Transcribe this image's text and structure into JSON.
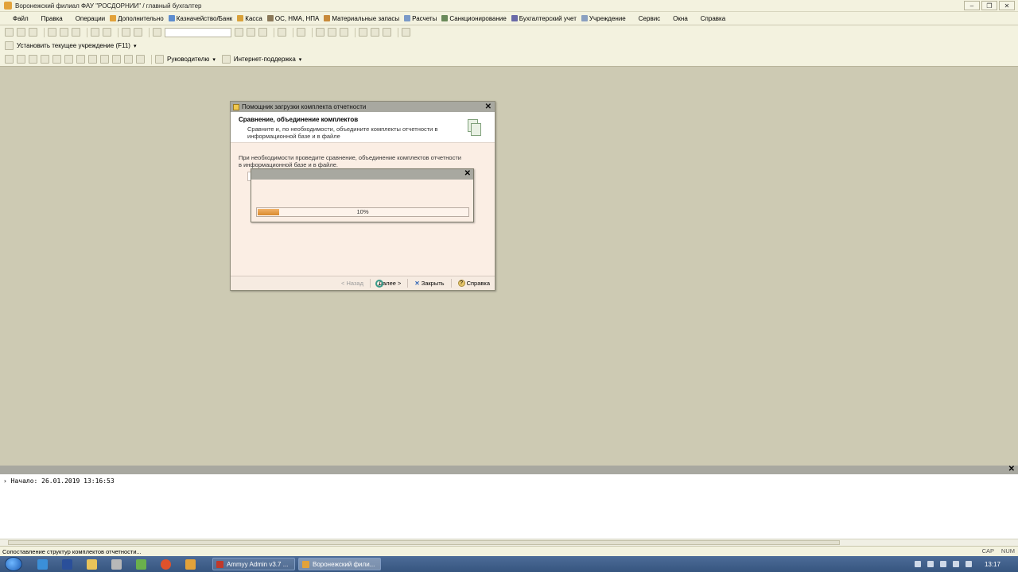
{
  "window": {
    "title": "Воронежский филиал ФАУ \"РОСДОРНИИ\" / главный бухгалтер"
  },
  "menu": [
    {
      "label": "Файл",
      "icon": "file-icon",
      "color": "#f3f2df"
    },
    {
      "label": "Правка",
      "icon": "edit-icon",
      "color": "#f3f2df"
    },
    {
      "label": "Операции",
      "icon": "operations-icon",
      "color": "#f3f2df"
    },
    {
      "label": "Дополнительно",
      "icon": "extra-icon",
      "color": "#e2a23a"
    },
    {
      "label": "Казначейство/Банк",
      "icon": "bank-icon",
      "color": "#5d8dcf"
    },
    {
      "label": "Касса",
      "icon": "cash-icon",
      "color": "#d9a23a"
    },
    {
      "label": "ОС, НМА, НПА",
      "icon": "assets-icon",
      "color": "#8c7a5a"
    },
    {
      "label": "Материальные запасы",
      "icon": "stock-icon",
      "color": "#c88a3a"
    },
    {
      "label": "Расчеты",
      "icon": "calc-icon",
      "color": "#7a9ac8"
    },
    {
      "label": "Санкционирование",
      "icon": "sanction-icon",
      "color": "#6a8a5a"
    },
    {
      "label": "Бухгалтерский учет",
      "icon": "ledger-icon",
      "color": "#6a6aa8"
    },
    {
      "label": "Учреждение",
      "icon": "org-icon",
      "color": "#8aa0c0"
    },
    {
      "label": "Сервис",
      "icon": "service-icon",
      "color": "#f3f2df"
    },
    {
      "label": "Окна",
      "icon": "windows-icon",
      "color": "#f3f2df"
    },
    {
      "label": "Справка",
      "icon": "help-icon",
      "color": "#f3f2df"
    }
  ],
  "toolbar2": {
    "set_org": "Установить текущее учреждение (F11)"
  },
  "toolbar3": {
    "manager": "Руководителю",
    "support": "Интернет-поддержка"
  },
  "wizard": {
    "title": "Помощник загрузки комплекта отчетности",
    "heading": "Сравнение, объединение комплектов",
    "subheading": "Сравните и, по необходимости, объедините комплекты отчетности в информационной базе и в файле",
    "body": "При необходимости проведите сравнение, объединение комплектов отчетности в информационной базе и в файле.",
    "back": "< Назад",
    "next": "Далее >",
    "close": "Закрыть",
    "help": "Справка"
  },
  "progress": {
    "percent_label": "10%",
    "value": 0.1
  },
  "messages": {
    "line": "Начало: 26.01.2019 13:16:53"
  },
  "status": {
    "text": "Сопоставление структур комплектов отчетности...",
    "cap": "CAP",
    "num": "NUM"
  },
  "taskbar": {
    "tasks": [
      {
        "label": "Ammyy Admin v3.7 ...",
        "active": false,
        "color": "#c0392b"
      },
      {
        "label": "Воронежский фили...",
        "active": true,
        "color": "#e2a23a"
      }
    ],
    "clock": "13:17"
  }
}
